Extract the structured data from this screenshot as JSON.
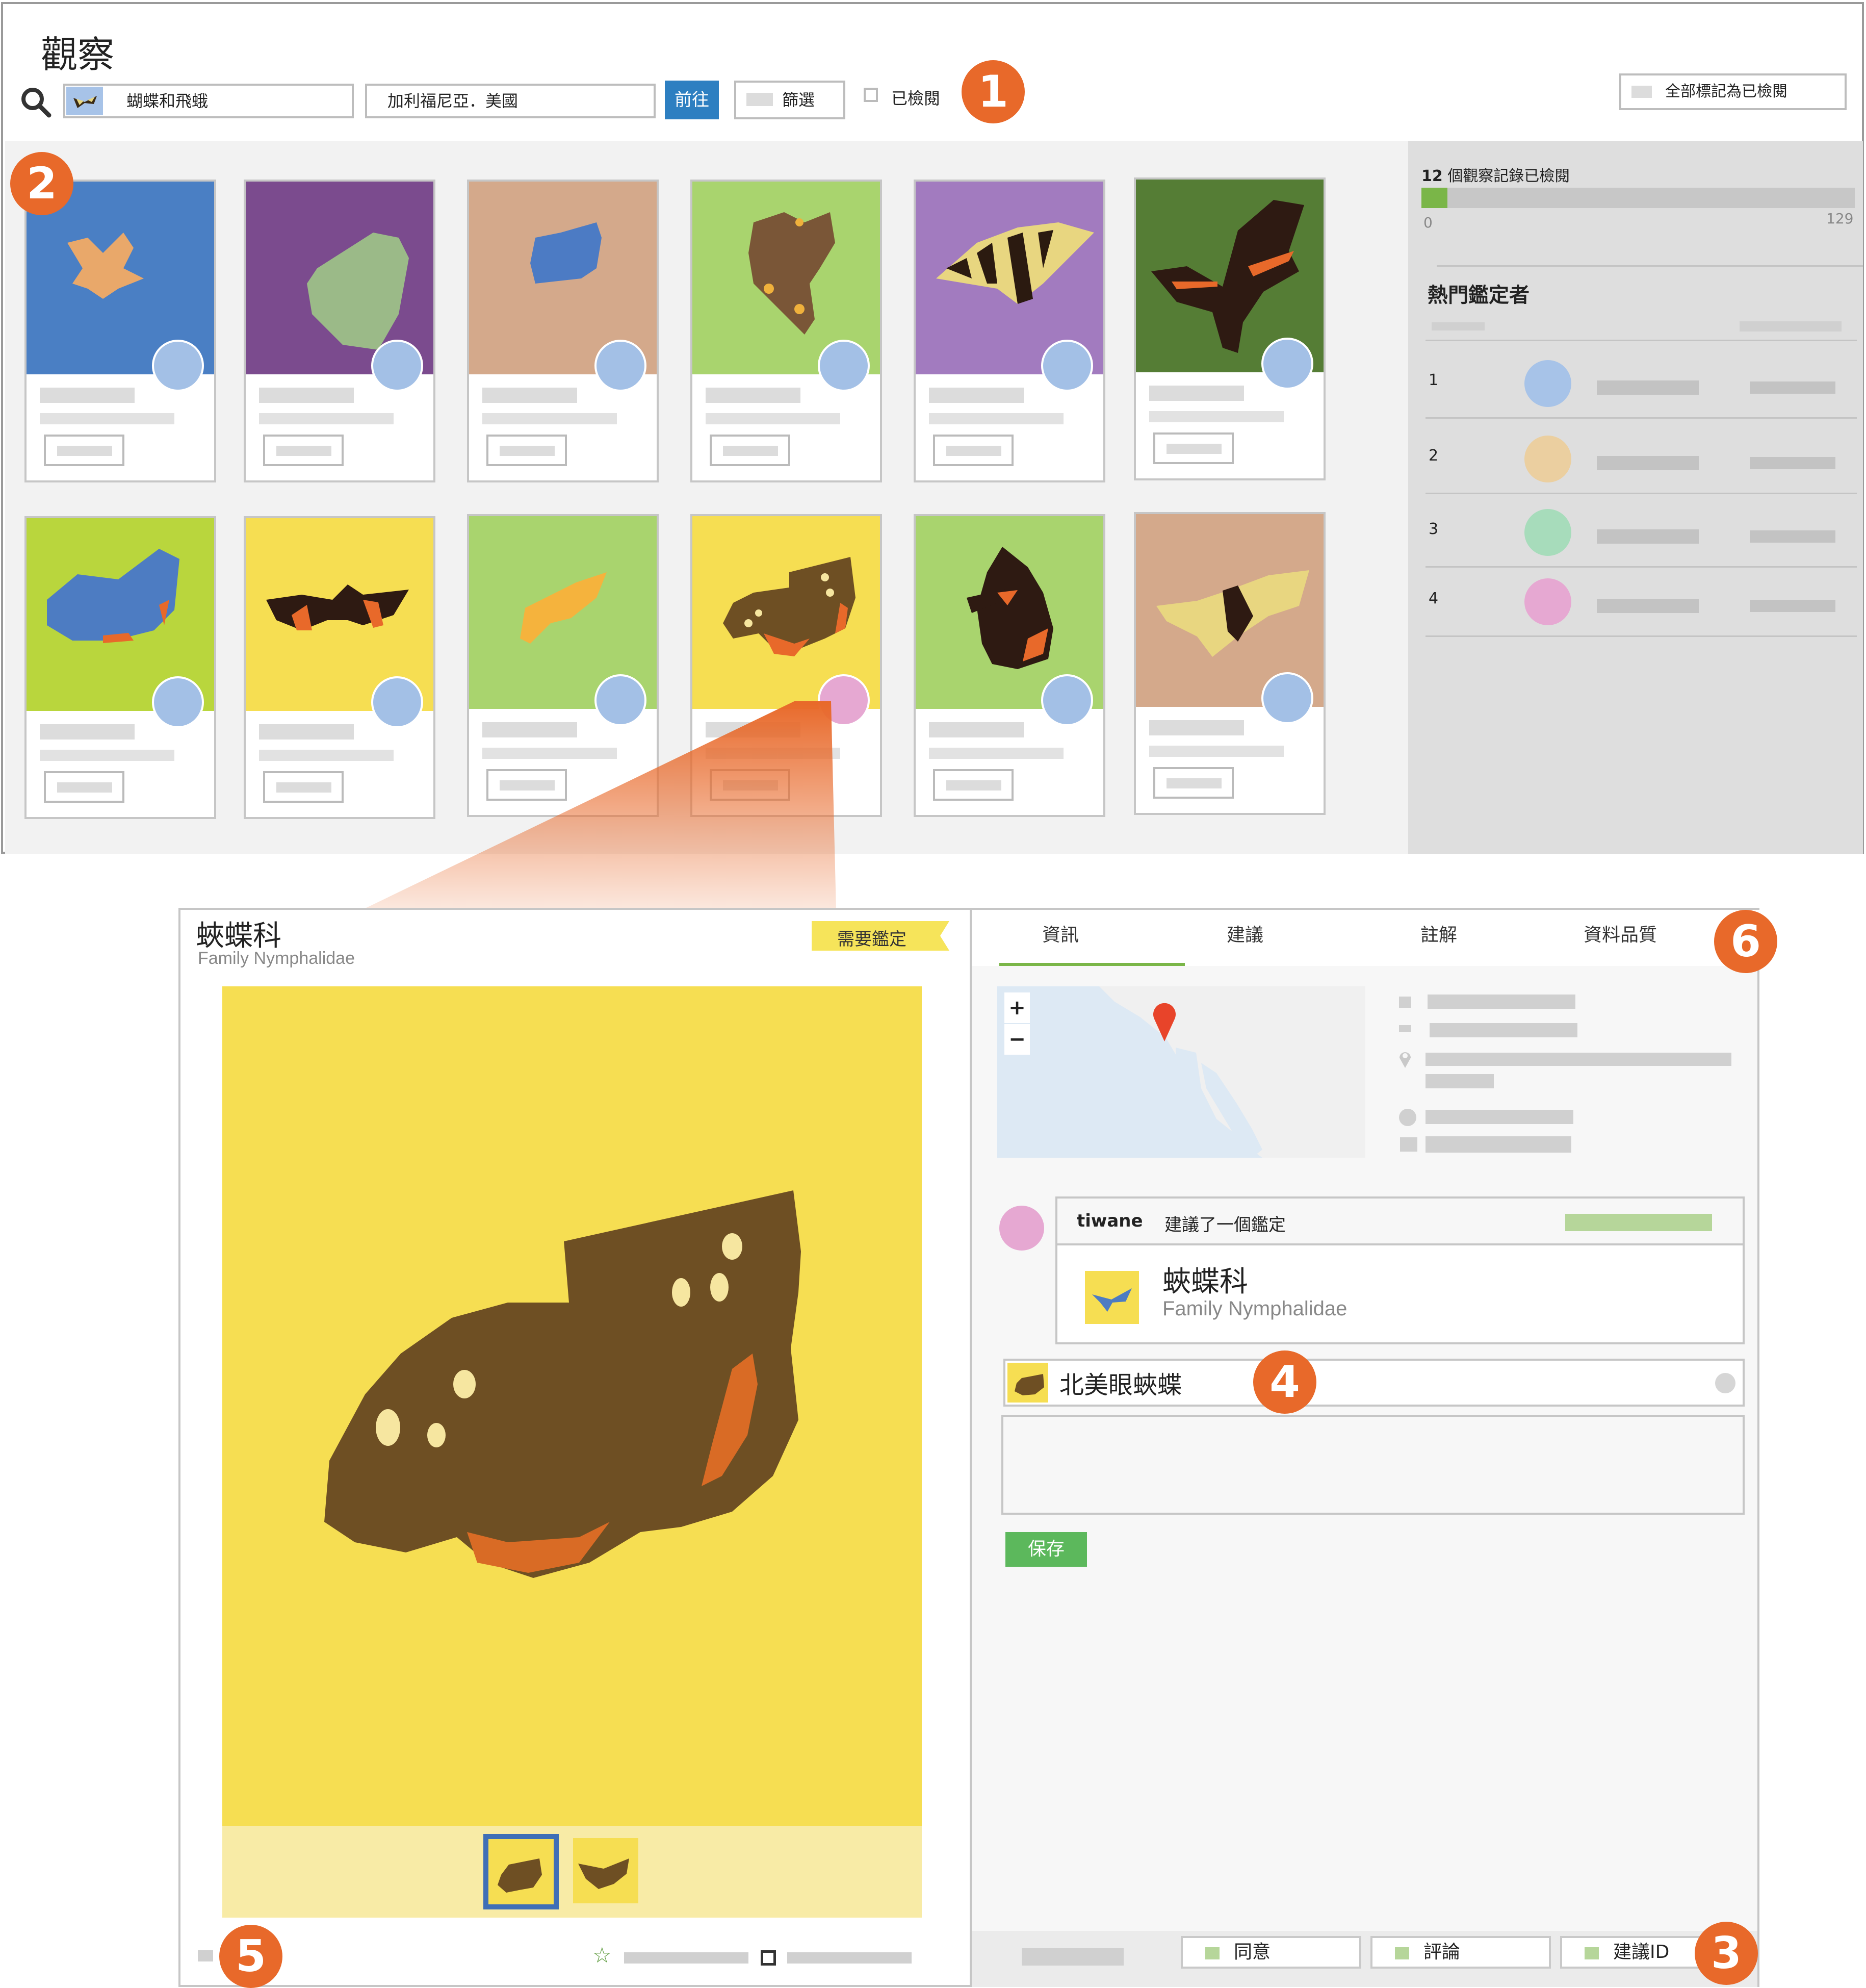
{
  "header": {
    "title": "觀察",
    "taxon_filter": "蝴蝶和飛蛾",
    "place_filter": "加利福尼亞．美國",
    "go_button": "前往",
    "filters_button": "篩選",
    "reviewed_checkbox": "已檢閱",
    "mark_all_button": "全部標記為已檢閱"
  },
  "badges": {
    "b1": "1",
    "b2": "2",
    "b3": "3",
    "b4": "4",
    "b5": "5",
    "b6": "6"
  },
  "sidebar": {
    "reviewed_count": "12",
    "reviewed_text": "個觀察記錄已檢閱",
    "progress": 0.06,
    "range_min": "0",
    "range_max": "129",
    "top_identifiers_title": "熱門鑑定者",
    "identifiers": [
      {
        "rank": "1",
        "color": "#a7c3e8"
      },
      {
        "rank": "2",
        "color": "#ebcfa0"
      },
      {
        "rank": "3",
        "color": "#a7dcbb"
      },
      {
        "rank": "4",
        "color": "#e6a8d2"
      }
    ]
  },
  "detail": {
    "taxon_name": "蛺蝶科",
    "taxon_scientific": "Family Nymphalidae",
    "quality_tag": "需要鑑定",
    "tabs": [
      "資訊",
      "建議",
      "註解",
      "資料品質"
    ],
    "active_tab": "資訊",
    "map_zoom_in": "+",
    "map_zoom_out": "−",
    "identification": {
      "user": "tiwane",
      "action": "建議了一個鑑定",
      "taxon_name": "蛺蝶科",
      "taxon_scientific": "Family Nymphalidae"
    },
    "suggest_input_value": "北美眼蛺蝶",
    "save_button": "保存",
    "footer_buttons": [
      "同意",
      "評論",
      "建議ID"
    ]
  },
  "colors": {
    "accent_orange": "#e8692a",
    "go_blue": "#2d7fc1",
    "save_green": "#5cb85c",
    "progress_green": "#7ab648"
  }
}
